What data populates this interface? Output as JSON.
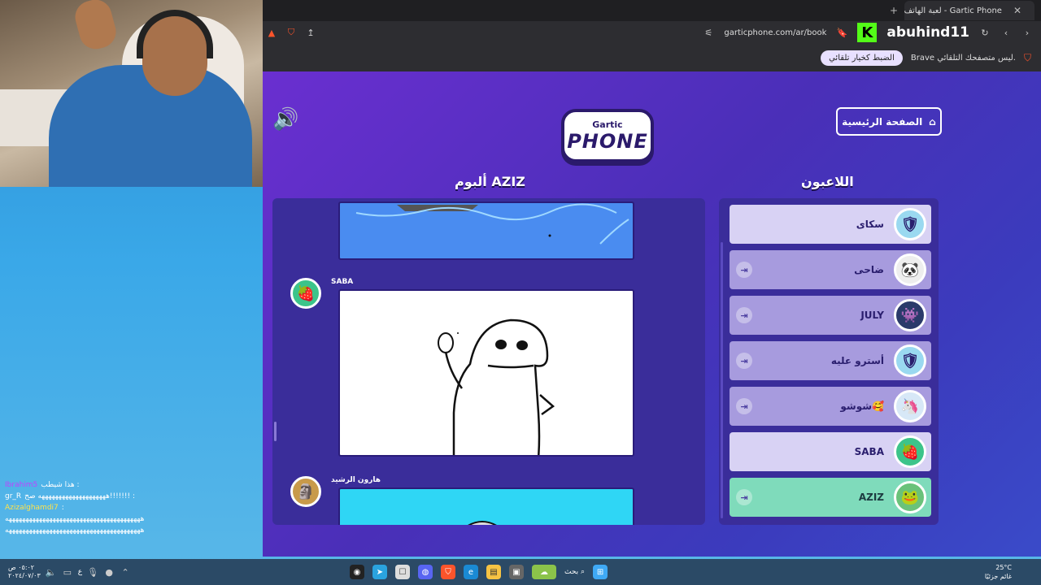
{
  "browser": {
    "tab_title": "Gartic Phone - لعبة الهاتف المكسور",
    "url": "garticphone.com/ar/book",
    "kick_username": "abuhind11",
    "infobar_text": "Brave ليس متصفحك التلقائي.",
    "infobar_button": "الضبط كخيار تلقائي",
    "badge_count": "3"
  },
  "game": {
    "logo_top": "Gartic",
    "logo_bottom": "PHONE",
    "home_button": "الصفحة الرئيسية",
    "album_title": "ألبوم AZIZ",
    "players_title": "اللاعبون",
    "album_entries": [
      {
        "author": "SABA"
      },
      {
        "author": "هارون الرشيد"
      }
    ],
    "players": [
      {
        "name": "سكاى"
      },
      {
        "name": "ضاحى"
      },
      {
        "name": "JULY"
      },
      {
        "name": "أسترو عليه"
      },
      {
        "name": "شوشو🥰"
      },
      {
        "name": "SABA"
      },
      {
        "name": "AZIZ"
      }
    ],
    "colors": {
      "accent_green": "#7fdbbb",
      "panel": "#3a2d9a"
    }
  },
  "chat": [
    {
      "user": "Ibrahim5",
      "message": ": هذا شيطب"
    },
    {
      "user": "gr_R",
      "message": ": !!!!!!!ههههههههههههههههههههه صح"
    },
    {
      "user": "Azizalghamdi7",
      "message": ":"
    },
    {
      "user": "",
      "message": "ههههههههههههههههههههههههههههههههههههههههه"
    },
    {
      "user": "",
      "message": "ههههههههههههههههههههههههههههههههههههههههه"
    }
  ],
  "taskbar": {
    "search": "بحث",
    "lang": "ع",
    "time": "٠٥:٠٢ ص",
    "date": "٢٠٢٤/٠٧/٠٣",
    "weather_temp": "25°C",
    "weather_desc": "غائم جزئيًا"
  }
}
